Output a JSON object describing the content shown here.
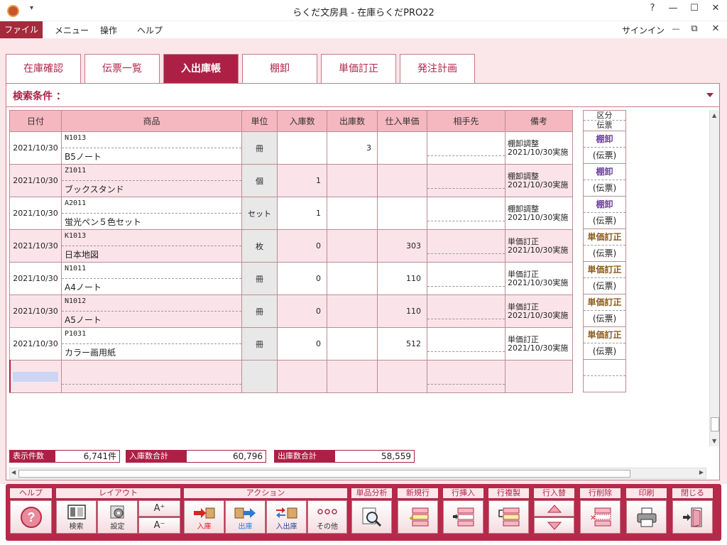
{
  "window": {
    "title": "らくだ文房具 - 在庫らくだPRO22",
    "qa_dropdown": "▾",
    "help": "?",
    "minimize": "—",
    "maximize": "☐",
    "close": "✕",
    "restore": "⧉"
  },
  "menu": {
    "file": "ファイル",
    "items": [
      "メニュー",
      "操作",
      "ヘルプ"
    ],
    "signin": "サインイン"
  },
  "tabs": [
    "在庫確認",
    "伝票一覧",
    "入出庫帳",
    "棚卸",
    "単価訂正",
    "発注計画"
  ],
  "search": {
    "label": "検索条件 ："
  },
  "grid": {
    "headers": {
      "date": "日付",
      "product": "商品",
      "unit": "単位",
      "in": "入庫数",
      "out": "出庫数",
      "price": "仕入単価",
      "partner": "相手先",
      "note": "備考"
    },
    "kbn_header": [
      "区分",
      "伝票"
    ],
    "rows": [
      {
        "date": "2021/10/30",
        "code": "N1013",
        "name": "B5ノート",
        "unit": "冊",
        "in": "",
        "out": "3",
        "price": "",
        "note1": "棚卸調整",
        "note2": "2021/10/30実施",
        "kbn": "棚卸",
        "kbn2": "(伝票)"
      },
      {
        "date": "2021/10/30",
        "code": "Z1011",
        "name": "ブックスタンド",
        "unit": "個",
        "in": "1",
        "out": "",
        "price": "",
        "note1": "棚卸調整",
        "note2": "2021/10/30実施",
        "kbn": "棚卸",
        "kbn2": "(伝票)"
      },
      {
        "date": "2021/10/30",
        "code": "A2011",
        "name": "蛍光ペン５色セット",
        "unit": "セット",
        "in": "1",
        "out": "",
        "price": "",
        "note1": "棚卸調整",
        "note2": "2021/10/30実施",
        "kbn": "棚卸",
        "kbn2": "(伝票)"
      },
      {
        "date": "2021/10/30",
        "code": "K1013",
        "name": "日本地図",
        "unit": "枚",
        "in": "0",
        "out": "",
        "price": "303",
        "note1": "単価訂正",
        "note2": "2021/10/30実施",
        "kbn": "単価訂正",
        "kbn2": "(伝票)"
      },
      {
        "date": "2021/10/30",
        "code": "N1011",
        "name": "A4ノート",
        "unit": "冊",
        "in": "0",
        "out": "",
        "price": "110",
        "note1": "単価訂正",
        "note2": "2021/10/30実施",
        "kbn": "単価訂正",
        "kbn2": "(伝票)"
      },
      {
        "date": "2021/10/30",
        "code": "N1012",
        "name": "A5ノート",
        "unit": "冊",
        "in": "0",
        "out": "",
        "price": "110",
        "note1": "単価訂正",
        "note2": "2021/10/30実施",
        "kbn": "単価訂正",
        "kbn2": "(伝票)"
      },
      {
        "date": "2021/10/30",
        "code": "P1031",
        "name": "カラー画用紙",
        "unit": "冊",
        "in": "0",
        "out": "",
        "price": "512",
        "note1": "単価訂正",
        "note2": "2021/10/30実施",
        "kbn": "単価訂正",
        "kbn2": "(伝票)"
      }
    ]
  },
  "totals": {
    "count_label": "表示件数",
    "count": "6,741件",
    "in_label": "入庫数合計",
    "in": "60,796",
    "out_label": "出庫数合計",
    "out": "58,559"
  },
  "toolbar": {
    "groups": {
      "help": "ヘルプ",
      "layout": "レイアウト",
      "action": "アクション",
      "analysis": "単品分析",
      "new_row": "新規行",
      "insert_row": "行挿入",
      "copy_row": "行複製",
      "swap_row": "行入替",
      "delete_row": "行削除",
      "print": "印刷",
      "close": "閉じる"
    },
    "buttons": {
      "search": "検索",
      "settings": "設定",
      "font_up": "A⁺",
      "font_down": "A⁻",
      "in": "入庫",
      "out": "出庫",
      "inout": "入出庫",
      "other": "その他"
    }
  },
  "colors": {
    "accent": "#ad2046",
    "header": "#f5b8c1",
    "row_alt": "#fbe4e9",
    "kbn_stock": "#6a3fa0",
    "kbn_price": "#8b5a1a"
  }
}
